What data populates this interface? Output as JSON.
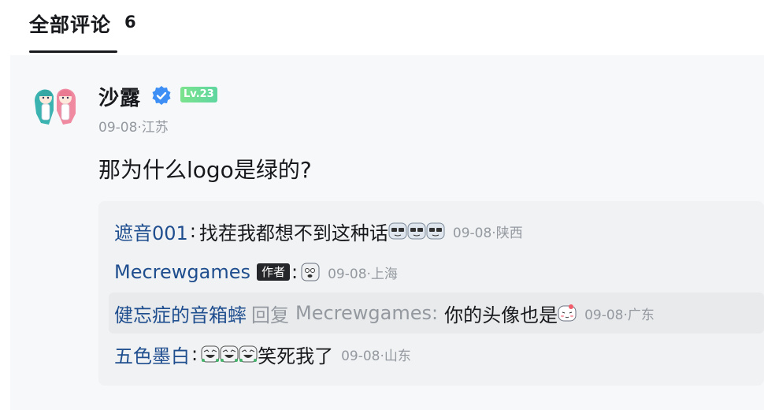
{
  "header": {
    "title": "全部评论",
    "count": "6"
  },
  "comment": {
    "username": "沙露",
    "level": "Lv.23",
    "meta": "09-08·江苏",
    "content": "那为什么logo是绿的?"
  },
  "replies": [
    {
      "user": "遮音001",
      "text": "找茬我都想不到这种话",
      "emojis": [
        "sunglasses-emoji",
        "sunglasses-emoji",
        "sunglasses-emoji"
      ],
      "time": "09-08·陕西"
    },
    {
      "user": "Mecrewgames",
      "author_tag": "作者",
      "emojis": [
        "face-emoji"
      ],
      "time": "09-08·上海"
    },
    {
      "user": "健忘症的音箱蟀",
      "reply_word": "回复",
      "target": "Mecrewgames:",
      "text": "你的头像也是",
      "emojis": [
        "blush-emoji"
      ],
      "time": "09-08·广东"
    },
    {
      "user": "五色墨白",
      "emojis": [
        "laugh-emoji",
        "laugh-emoji",
        "laugh-emoji"
      ],
      "text": "笑死我了",
      "time": "09-08·山东"
    }
  ],
  "colors": {
    "username_link": "#1f4e8f",
    "muted": "#9499a0",
    "verified": "#3d8ff5",
    "level_badge": "#6ddc95"
  }
}
